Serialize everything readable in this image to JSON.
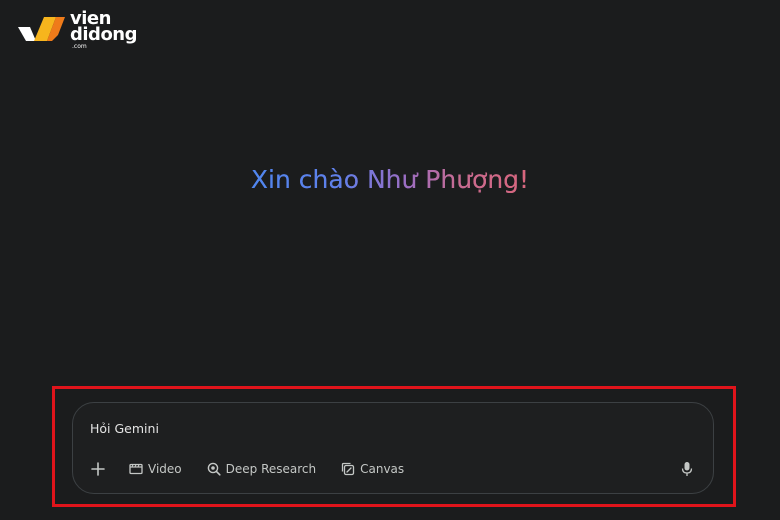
{
  "watermark": {
    "line1": "vien",
    "line2": "didong",
    "suffix": ".com"
  },
  "greeting": {
    "text": "Xin chào Như Phượng!"
  },
  "prompt": {
    "placeholder": "Hỏi Gemini",
    "tools": {
      "add_icon": "plus-icon",
      "video_label": "Video",
      "video_icon": "film-icon",
      "deep_research_label": "Deep Research",
      "deep_research_icon": "deep-research-icon",
      "canvas_label": "Canvas",
      "canvas_icon": "canvas-icon"
    },
    "mic_icon": "microphone-icon"
  },
  "colors": {
    "background": "#1b1c1d",
    "card_border": "#3c4043",
    "highlight_border": "#e0141b",
    "greeting_gradient": [
      "#4f86ee",
      "#9a6ec4",
      "#d9657a"
    ],
    "logo_yellow": "#f7b51d",
    "logo_orange": "#ef7b1a"
  }
}
